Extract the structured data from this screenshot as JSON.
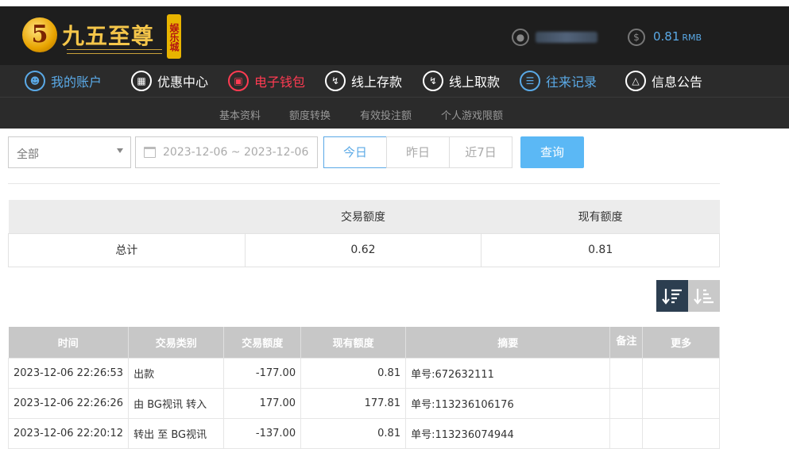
{
  "brand": {
    "badge": "5",
    "name": "九五至尊",
    "tag": "娱乐城"
  },
  "account": {
    "balance": "0.81",
    "currency": "RMB"
  },
  "nav": {
    "items": [
      {
        "label": "我的账户",
        "icon": "user-icon"
      },
      {
        "label": "优惠中心",
        "icon": "gift-icon"
      },
      {
        "label": "电子钱包",
        "icon": "wallet-icon"
      },
      {
        "label": "线上存款",
        "icon": "deposit-icon"
      },
      {
        "label": "线上取款",
        "icon": "withdraw-icon"
      },
      {
        "label": "往来记录",
        "icon": "record-icon"
      },
      {
        "label": "信息公告",
        "icon": "bell-icon"
      }
    ]
  },
  "subnav": {
    "items": [
      "基本资料",
      "额度转换",
      "有效投注额",
      "个人游戏限额"
    ]
  },
  "filter": {
    "type_selected": "全部",
    "date_range": "2023-12-06 ~ 2023-12-06",
    "quick": [
      "今日",
      "昨日",
      "近7日"
    ],
    "query_label": "查询"
  },
  "summary": {
    "headers": [
      "",
      "交易额度",
      "现有额度"
    ],
    "row": [
      "总计",
      "0.62",
      "0.81"
    ]
  },
  "records": {
    "headers": [
      "时间",
      "交易类别",
      "交易额度",
      "现有额度",
      "摘要",
      "备注",
      "更多"
    ],
    "rows": [
      {
        "time": "2023-12-06 22:26:53",
        "type": "出款",
        "amount": "-177.00",
        "balance": "0.81",
        "summary": "单号:672632111"
      },
      {
        "time": "2023-12-06 22:26:26",
        "type": "由 BG视讯 转入",
        "amount": "177.00",
        "balance": "177.81",
        "summary": "单号:113236106176"
      },
      {
        "time": "2023-12-06 22:20:12",
        "type": "转出 至 BG视讯",
        "amount": "-137.00",
        "balance": "0.81",
        "summary": "单号:113236074944"
      }
    ]
  },
  "colors": {
    "accent": "#5aa9e6",
    "active_nav": "#ff3b52",
    "header_bg": "#1e1e1e",
    "query_button": "#5bb8f5"
  }
}
